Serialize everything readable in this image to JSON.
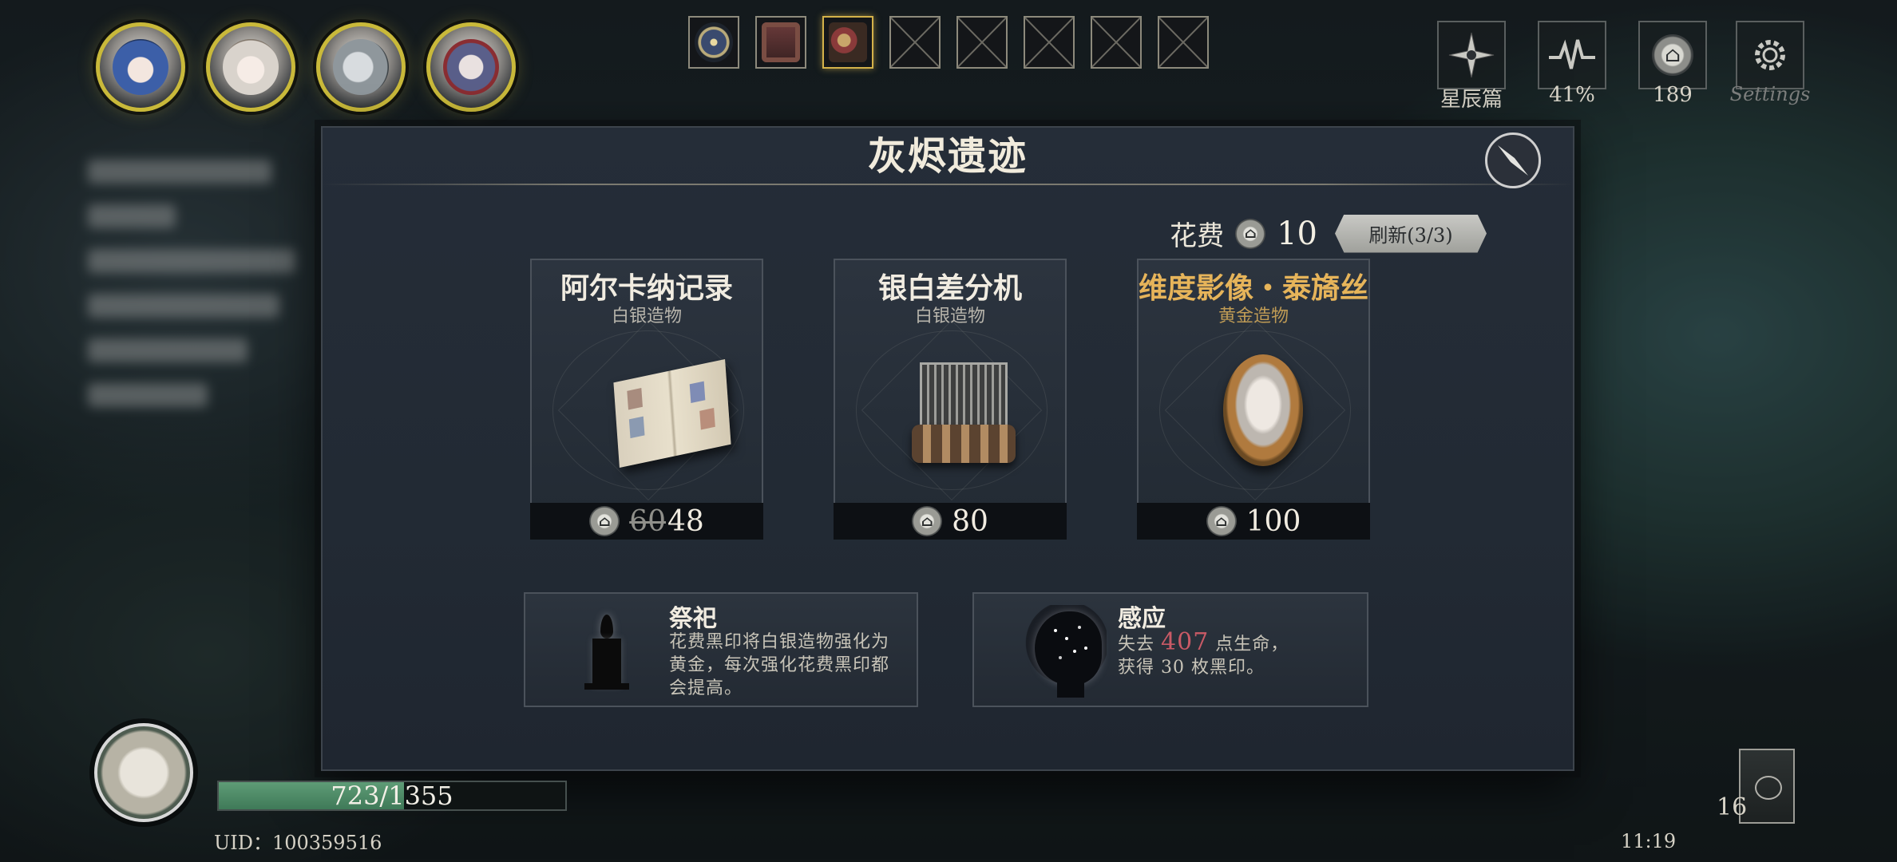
{
  "party": [
    {
      "name": "party-member-1"
    },
    {
      "name": "party-member-2"
    },
    {
      "name": "party-member-3"
    },
    {
      "name": "party-member-4"
    }
  ],
  "relic_slots": {
    "filled": 3,
    "total": 8
  },
  "top_icons": {
    "chapter_label": "星辰篇",
    "pulse_label": "41%",
    "currency_label": "189",
    "settings_label": "Settings"
  },
  "modal": {
    "title": "灰烬遗迹",
    "cost_label": "花费",
    "cost_value": "10",
    "refresh_label": "刷新(3/3)"
  },
  "shop_items": [
    {
      "name": "阿尔卡纳记录",
      "tier": "白银造物",
      "price_old": "60",
      "price": "48",
      "rarity": "silver"
    },
    {
      "name": "银白差分机",
      "tier": "白银造物",
      "price": "80",
      "rarity": "silver"
    },
    {
      "name": "维度影像・泰旖丝",
      "tier": "黄金造物",
      "price": "100",
      "rarity": "gold"
    }
  ],
  "actions": {
    "sacrifice": {
      "title": "祭祀",
      "desc": "花费黑印将白银造物强化为黄金，每次强化花费黑印都会提高。"
    },
    "sense": {
      "title": "感应",
      "desc_part1": "失去",
      "desc_hl": "407",
      "desc_part2": "点生命，",
      "desc_part3": "获得 30 枚黑印。"
    }
  },
  "player": {
    "hp_current": 723,
    "hp_max": 1355,
    "hp_text": "723/1355",
    "uid": "UID：100359516",
    "time": "11:19",
    "deck_count": "16"
  },
  "colors": {
    "accent_gold": "#e6b45a",
    "hp_green": "#4f8c66",
    "highlight_red": "#c95a66"
  }
}
